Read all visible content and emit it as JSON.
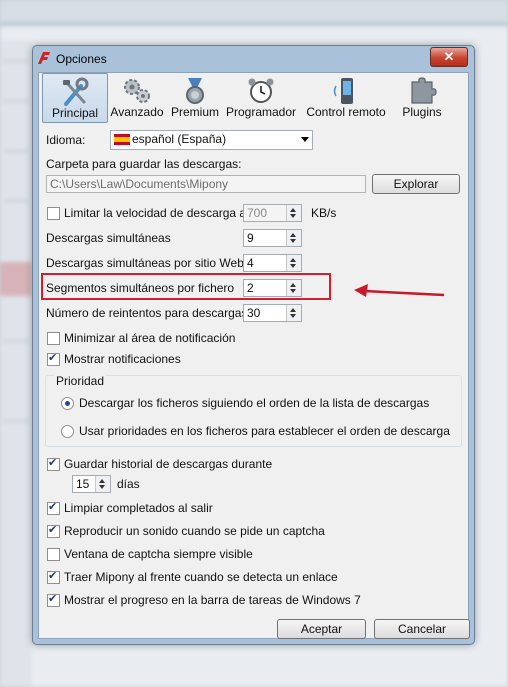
{
  "window": {
    "title": "Opciones",
    "close_glyph": "✕"
  },
  "tabs": [
    {
      "label": "Principal",
      "icon": "tools-icon"
    },
    {
      "label": "Avanzado",
      "icon": "gears-icon"
    },
    {
      "label": "Premium",
      "icon": "medal-icon"
    },
    {
      "label": "Programador",
      "icon": "alarm-clock-icon"
    },
    {
      "label": "Control remoto",
      "icon": "phone-icon"
    },
    {
      "label": "Plugins",
      "icon": "puzzle-icon"
    }
  ],
  "general": {
    "language_label": "Idioma:",
    "language_value": "español (España)",
    "folder_label": "Carpeta para guardar las descargas:",
    "folder_value": "C:\\Users\\Law\\Documents\\Mipony",
    "browse_label": "Explorar"
  },
  "limits": {
    "speed_limit_label": "Limitar la velocidad de descarga a",
    "speed_limit_value": "700",
    "speed_unit": "KB/s",
    "simultaneous_label": "Descargas simultáneas",
    "simultaneous_value": "9",
    "per_site_label": "Descargas simultáneas por sitio Web",
    "per_site_value": "4",
    "segments_label": "Segmentos simultáneos por fichero",
    "segments_value": "2",
    "retries_label": "Número de reintentos para descargas",
    "retries_value": "30"
  },
  "options": {
    "minimize_tray": "Minimizar al área de notificación",
    "show_notifications": "Mostrar notificaciones"
  },
  "priority": {
    "group_label": "Prioridad",
    "option1": "Descargar los ficheros siguiendo el orden de la lista de descargas",
    "option2": "Usar prioridades en los ficheros para establecer el orden de descarga"
  },
  "history": {
    "label": "Guardar historial de descargas durante",
    "days_value": "15",
    "days_unit": "días"
  },
  "more": {
    "clean_completed": "Limpiar completados al salir",
    "play_sound": "Reproducir un sonido cuando se pide un captcha",
    "captcha_window": "Ventana de captcha siempre visible",
    "bring_front": "Traer Mipony al frente cuando se detecta un enlace",
    "taskbar_progress": "Mostrar el progreso en la barra de tareas de Windows 7"
  },
  "footer": {
    "accept": "Aceptar",
    "cancel": "Cancelar"
  },
  "colors": {
    "highlight": "#d0202f"
  }
}
